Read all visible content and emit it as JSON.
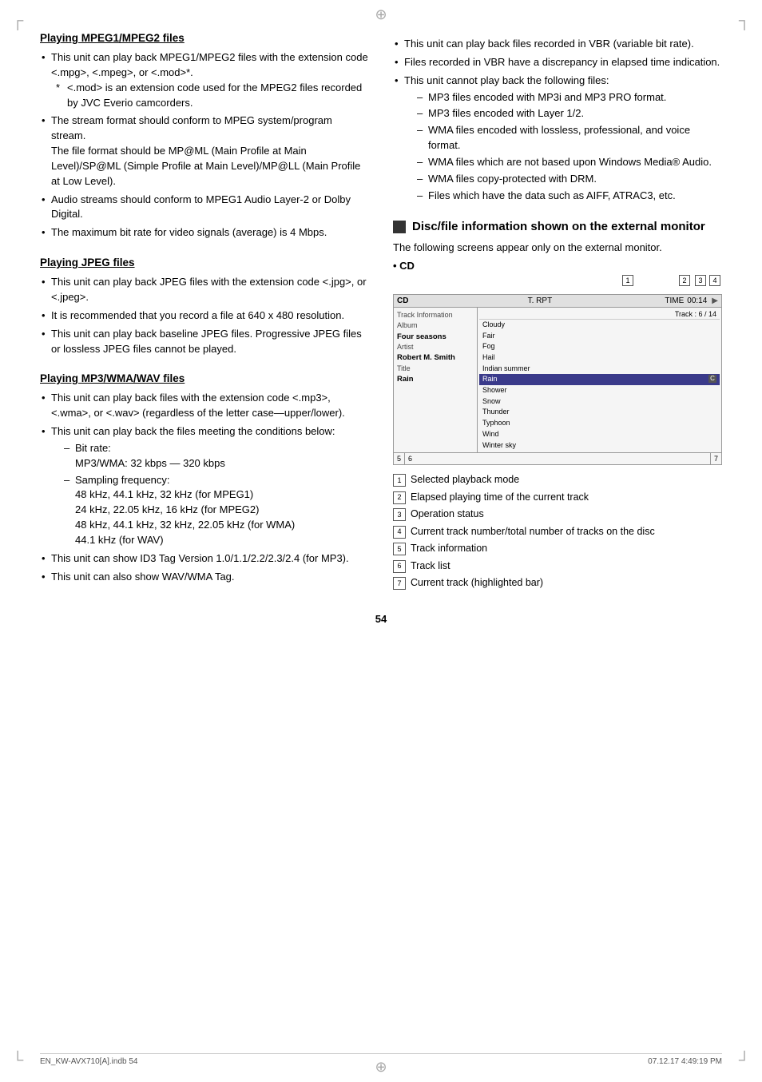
{
  "decorations": {
    "top_center": "⊕",
    "bottom_center": "⊕",
    "corner_tl": "",
    "corner_tr": "",
    "corner_bl": "",
    "corner_br": ""
  },
  "left_column": {
    "section1": {
      "title": "Playing MPEG1/MPEG2 files",
      "bullets": [
        {
          "text": "This unit can play back MPEG1/MPEG2 files with the extension code <.mpg>, <.mpeg>, or <.mod>*.",
          "sub": [
            "* <.mod> is an extension code used for the MPEG2 files recorded by JVC Everio camcorders."
          ]
        },
        {
          "text": "The stream format should conform to MPEG system/program stream. The file format should be MP@ML (Main Profile at Main Level)/SP@ML (Simple Profile at Main Level)/MP@LL (Main Profile at Low Level)."
        },
        {
          "text": "Audio streams should conform to MPEG1 Audio Layer-2 or Dolby Digital."
        },
        {
          "text": "The maximum bit rate for video signals (average) is 4 Mbps."
        }
      ]
    },
    "section2": {
      "title": "Playing JPEG files",
      "bullets": [
        {
          "text": "This unit can play back JPEG files with the extension code <.jpg>, or <.jpeg>."
        },
        {
          "text": "It is recommended that you record a file at 640 x 480 resolution."
        },
        {
          "text": "This unit can play back baseline JPEG files. Progressive JPEG files or lossless JPEG files cannot be played."
        }
      ]
    },
    "section3": {
      "title": "Playing MP3/WMA/WAV files",
      "bullets": [
        {
          "text": "This unit can play back files with the extension code <.mp3>, <.wma>, or <.wav> (regardless of the letter case—upper/lower)."
        },
        {
          "text": "This unit can play back the files meeting the conditions below:",
          "dashes": [
            "Bit rate:\nMP3/WMA: 32 kbps — 320 kbps",
            "Sampling frequency:\n48 kHz, 44.1 kHz, 32 kHz (for MPEG1)\n24 kHz, 22.05 kHz, 16 kHz (for MPEG2)\n48 kHz, 44.1 kHz, 32 kHz, 22.05 kHz (for WMA)\n44.1 kHz (for WAV)"
          ]
        },
        {
          "text": "This unit can show ID3 Tag Version 1.0/1.1/2.2/2.3/2.4 (for MP3)."
        },
        {
          "text": "This unit can also show WAV/WMA Tag."
        }
      ]
    }
  },
  "right_column": {
    "vbr_bullets": [
      {
        "text": "This unit can play back files recorded in VBR (variable bit rate)."
      },
      {
        "text": "Files recorded in VBR have a discrepancy in elapsed time indication."
      },
      {
        "text": "This unit cannot play back the following files:",
        "dashes": [
          "MP3 files encoded with MP3i and MP3 PRO format.",
          "MP3 files encoded with Layer 1/2.",
          "WMA files encoded with lossless, professional, and voice format.",
          "WMA files which are not based upon Windows Media® Audio.",
          "WMA files copy-protected with DRM.",
          "Files which have the data such as AIFF, ATRAC3, etc."
        ]
      }
    ],
    "disc_section": {
      "title": "Disc/file information shown on the external monitor",
      "intro": "The following screens appear only on the external monitor.",
      "cd_label": "• CD",
      "diagram": {
        "cd_text": "CD",
        "trpt_text": "T. RPT",
        "time_label": "TIME",
        "time_value": "00:14",
        "track_header": "Track :  6 / 14",
        "tracks": [
          "Cloudy",
          "Fair",
          "Fog",
          "Hail",
          "Indian summer",
          "Rain",
          "Shower",
          "Snow",
          "Thunder",
          "Typhoon",
          "Wind",
          "Winter sky"
        ],
        "highlighted_track": "Rain",
        "left_info": [
          {
            "label": "Track Information",
            "value": ""
          },
          {
            "label": "Album",
            "value": ""
          },
          {
            "label": "Four seasons",
            "value": ""
          },
          {
            "label": "Artist",
            "value": ""
          },
          {
            "label": "Robert M. Smith",
            "value": ""
          },
          {
            "label": "Title",
            "value": ""
          },
          {
            "label": "Rain",
            "value": ""
          }
        ],
        "numbers_top": [
          "1",
          "2",
          "3",
          "4"
        ],
        "numbers_bottom": [
          "5",
          "6",
          "7"
        ]
      },
      "legend": [
        {
          "num": "1",
          "text": "Selected playback mode"
        },
        {
          "num": "2",
          "text": "Elapsed playing time of the current track"
        },
        {
          "num": "3",
          "text": "Operation status"
        },
        {
          "num": "4",
          "text": "Current track number/total number of tracks on the disc"
        },
        {
          "num": "5",
          "text": "Track information"
        },
        {
          "num": "6",
          "text": "Track list"
        },
        {
          "num": "7",
          "text": "Current track (highlighted bar)"
        }
      ]
    }
  },
  "page_number": "54",
  "footer": {
    "left": "EN_KW-AVX710[A].indb  54",
    "right": "07.12.17  4:49:19 PM"
  }
}
